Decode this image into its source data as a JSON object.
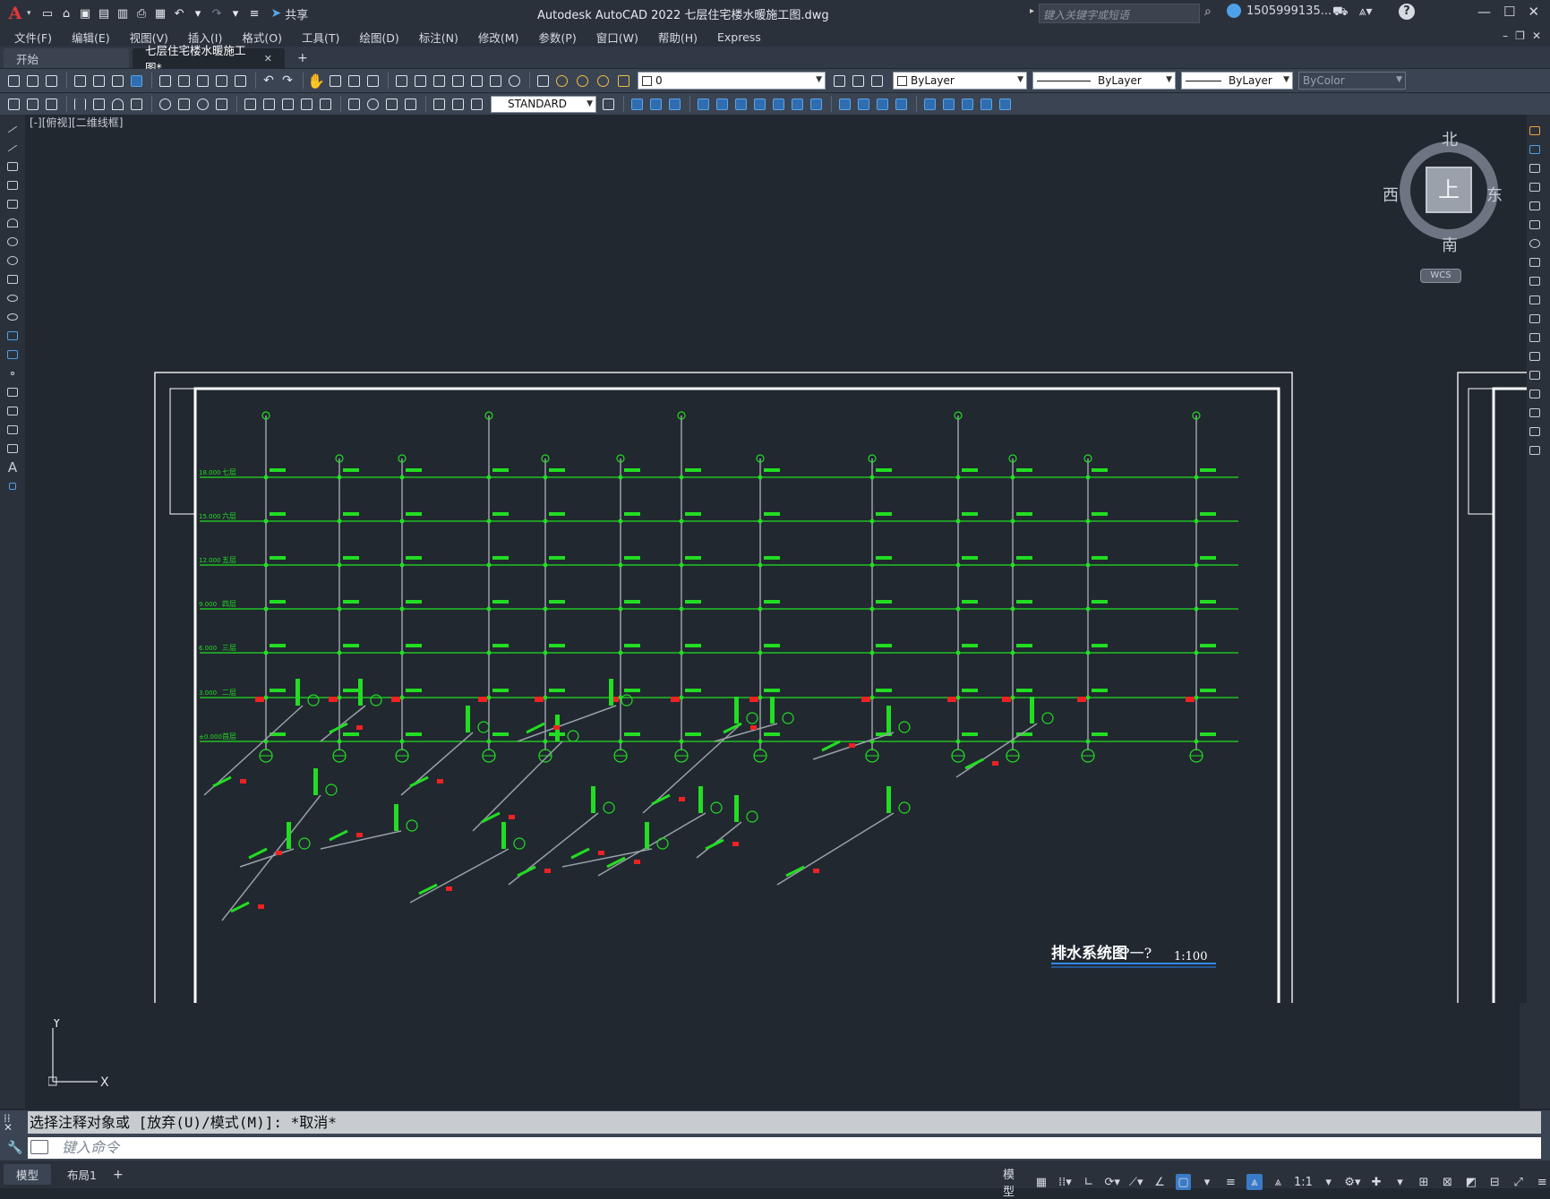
{
  "app": {
    "title": "Autodesk AutoCAD 2022    七层住宅楼水暖施工图.dwg",
    "search_placeholder": "键入关键字或短语",
    "user": "1505999135...",
    "share": "共享"
  },
  "menu": [
    "文件(F)",
    "编辑(E)",
    "视图(V)",
    "插入(I)",
    "格式(O)",
    "工具(T)",
    "绘图(D)",
    "标注(N)",
    "修改(M)",
    "参数(P)",
    "窗口(W)",
    "帮助(H)",
    "Express"
  ],
  "tabs": {
    "start": "开始",
    "active": "七层住宅楼水暖施工图*",
    "add": "+"
  },
  "toolbar": {
    "layer_value": "0",
    "color": "ByLayer",
    "linetype": "ByLayer",
    "lineweight": "ByLayer",
    "plotstyle": "ByColor",
    "textstyle": "STANDARD"
  },
  "viewport": {
    "label": "[-][俯视][二维线框]"
  },
  "viewcube": {
    "north": "北",
    "south": "南",
    "west": "西",
    "east": "东",
    "face": "上",
    "wcs": "WCS"
  },
  "ucs": {
    "x": "X",
    "y": "Y"
  },
  "drawing": {
    "title": "排水系统图",
    "title_mid": "?一?",
    "scale": "1:100",
    "floors": [
      "七层",
      "六层",
      "五层",
      "四层",
      "三层",
      "二层",
      "首层"
    ],
    "elevations": [
      "18.000",
      "15.000",
      "12.000",
      "9.000",
      "6.000",
      "3.000",
      "±0.000"
    ]
  },
  "command": {
    "history": "选择注释对象或 [放弃(U)/模式(M)]: *取消*",
    "placeholder": "键入命令"
  },
  "status": {
    "tabs": [
      "模型",
      "布局1"
    ],
    "add": "+",
    "model": "模型",
    "scale": "1:1"
  }
}
